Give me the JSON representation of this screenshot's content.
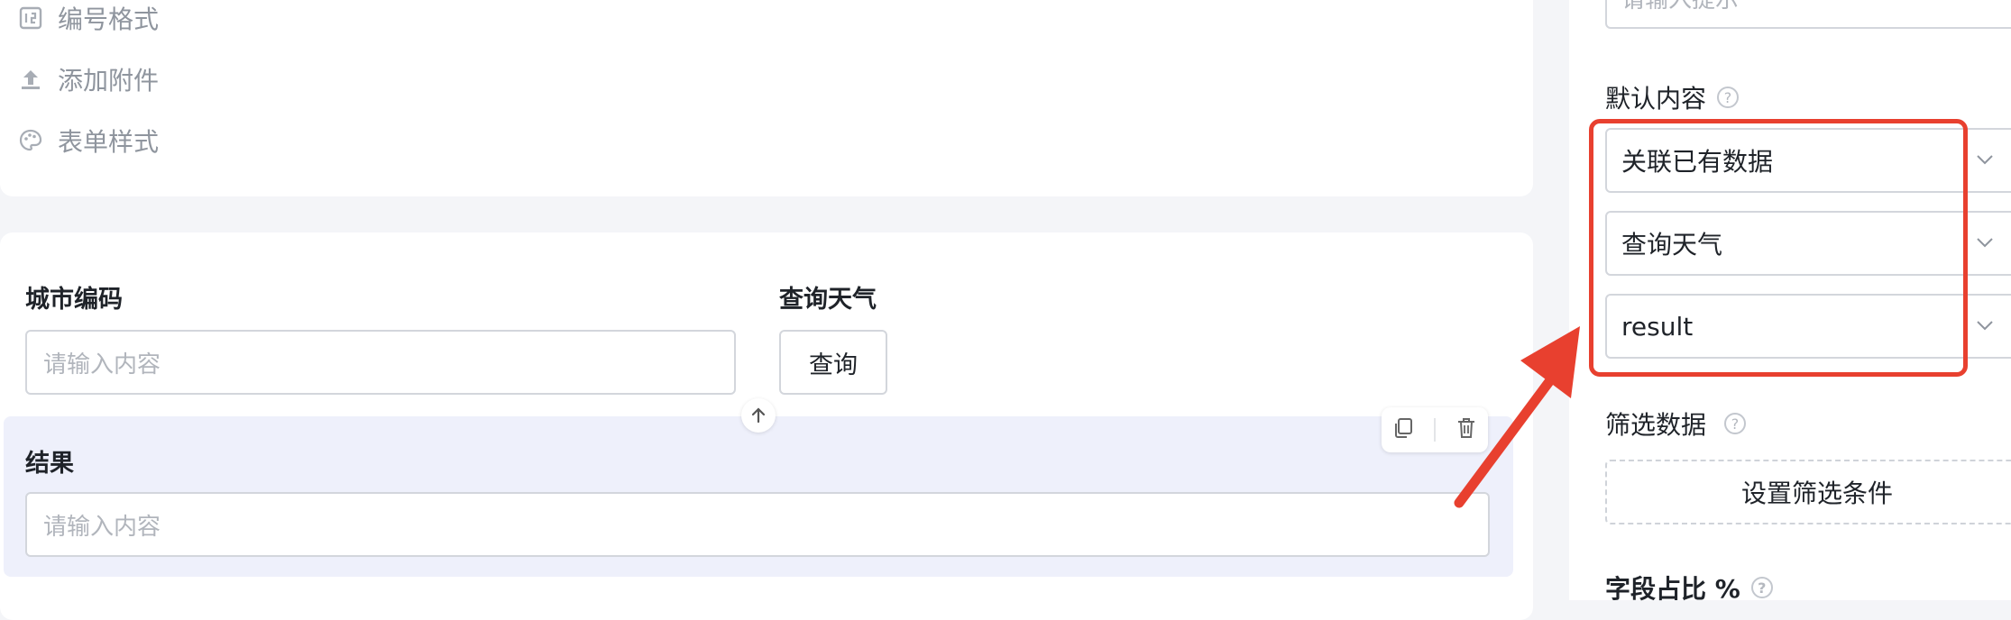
{
  "left_menu": {
    "items": [
      {
        "label": "编号格式",
        "icon": "number-format-icon"
      },
      {
        "label": "添加附件",
        "icon": "upload-icon"
      },
      {
        "label": "表单样式",
        "icon": "palette-icon"
      }
    ]
  },
  "form": {
    "city_code": {
      "label": "城市编码",
      "placeholder": "请输入内容"
    },
    "query_weather": {
      "label": "查询天气",
      "button_label": "查询"
    },
    "result": {
      "label": "结果",
      "placeholder": "请输入内容"
    }
  },
  "right_panel": {
    "top_input_placeholder": "请输入提示",
    "default_content_label": "默认内容",
    "selects": [
      {
        "value": "关联已有数据"
      },
      {
        "value": "查询天气"
      },
      {
        "value": "result"
      }
    ],
    "filter_label": "筛选数据",
    "filter_button": "设置筛选条件",
    "field_ratio_label": "字段占比 %"
  },
  "colors": {
    "annotation": "#e8402f",
    "selected_field_bg": "#eef0fb",
    "page_bg": "#f4f5f8"
  }
}
